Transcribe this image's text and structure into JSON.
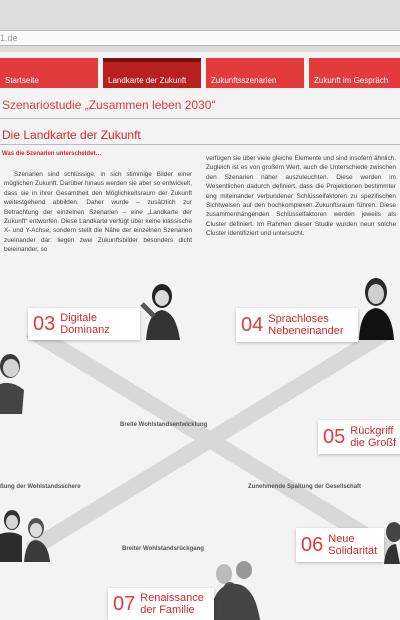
{
  "browser": {
    "url": "1.de"
  },
  "nav": {
    "tabs": [
      {
        "label": "Startseite",
        "active": false
      },
      {
        "label": "Landkarte der Zukunft",
        "active": true
      },
      {
        "label": "Zukunftsszenarien",
        "active": false
      },
      {
        "label": "Zukunft im Gespräch",
        "active": false
      }
    ]
  },
  "header": {
    "study_title": "Szenariostudie „Zusammen leben 2030“"
  },
  "article": {
    "title": "Die Landkarte der Zukunft",
    "subheading": "Was die Szenarien unterscheidet…",
    "col1": "Szenarien sind schlüssige, in sich stimmige Bilder einer möglichen Zukunft. Darüber hinaus werden sie aber so entwickelt, dass sie in ihrer Gesamtheit den Möglichkeits­raum der Zukunft weitestgehend abbilden. Daher wurde – zusätzlich zur Betrachtung der einzelnen Szenarien – eine „Landkarte der Zukunft“ entworfen. Diese Landkarte verfügt über keine klassische X- und Y-Achse, sondern stellt die Nähe der einzelnen Szenarien zueinander dar: liegen zwei Zukunftsbilder besonders dicht beieinander, so",
    "col2": "verfügen sie über viele gleiche Elemente und sind insofern ähnlich. Zugleich ist es von großem Wert, auch die Unter­schiede zwischen den Szenarien näher auszuleuchten. Diese werden im Wesentlichen dadurch definiert, dass die Projektionen bestimmter eng miteinander verbundener Schlüsselfaktoren zu spezifischen Sichtweisen auf den hochkomplexen Zukunftsraum führen. Diese zusammen­hängenden Schlüsselfaktoren werden jeweils als Cluster definiert. Im Rahmen dieser Studie wurden neun solche Cluster identifiziert und untersucht."
  },
  "map": {
    "clusters": [
      {
        "num": "03",
        "label_l1": "Digitale",
        "label_l2": "Dominanz"
      },
      {
        "num": "04",
        "label_l1": "Sprachloses",
        "label_l2": "Nebeneinander"
      },
      {
        "num": "05",
        "label_l1": "Rückgriff",
        "label_l2": "die Großf"
      },
      {
        "num": "06",
        "label_l1": "Neue",
        "label_l2": "Solidarität"
      },
      {
        "num": "07",
        "label_l1": "Renaissance",
        "label_l2": "der Familie"
      }
    ],
    "axes": {
      "top": "Breite Wohlstandsentwicklung",
      "left": "ßung der Wohlstandsschere",
      "right": "Zunehmende Spaltung der Gesellschaft",
      "bottom": "Breiter Wohlstandsrückgang"
    }
  },
  "colors": {
    "accent": "#e23b3b",
    "nav_active": "#b81f1f",
    "page_bg": "#f3f3f3"
  }
}
